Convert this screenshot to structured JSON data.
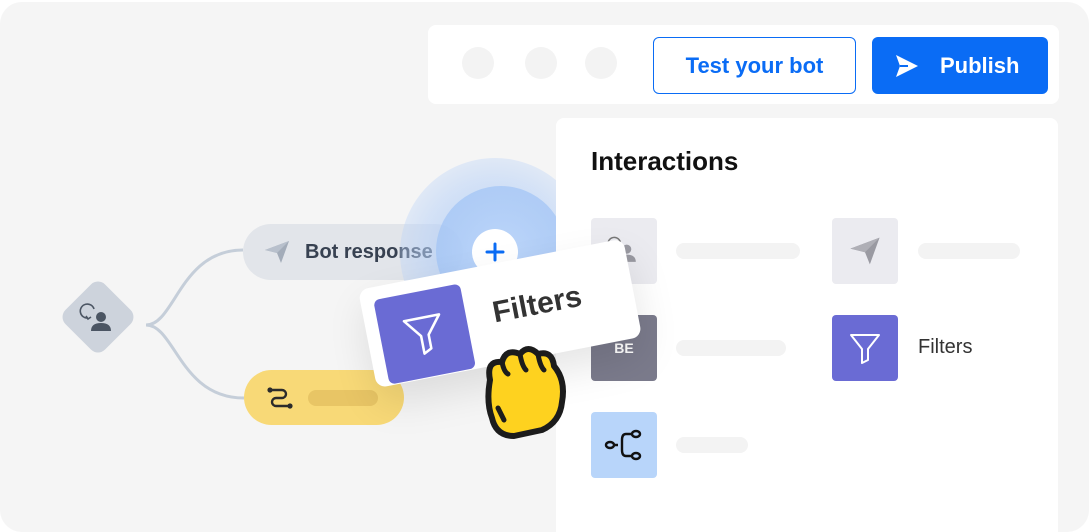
{
  "toolbar": {
    "test_button_label": "Test your bot",
    "publish_button_label": "Publish",
    "publish_icon": "send-icon",
    "accent_color": "#0a6cf5"
  },
  "panel": {
    "title": "Interactions",
    "items": [
      {
        "icon": "user-intent-icon",
        "label": ""
      },
      {
        "icon": "send-icon",
        "label": ""
      },
      {
        "icon": "code-block-icon",
        "tile_text": "BE",
        "label": ""
      },
      {
        "icon": "filter-icon",
        "label": "Filters"
      },
      {
        "icon": "branch-icon",
        "label": ""
      }
    ]
  },
  "flow": {
    "start_node_icon": "user-intent-icon",
    "bot_response_label": "Bot response",
    "bot_response_icon": "send-icon",
    "goto_node_icon": "route-icon",
    "add_button_icon": "plus-icon"
  },
  "drag_card": {
    "label": "Filters",
    "icon": "filter-icon",
    "cursor": "grab-hand-icon"
  }
}
